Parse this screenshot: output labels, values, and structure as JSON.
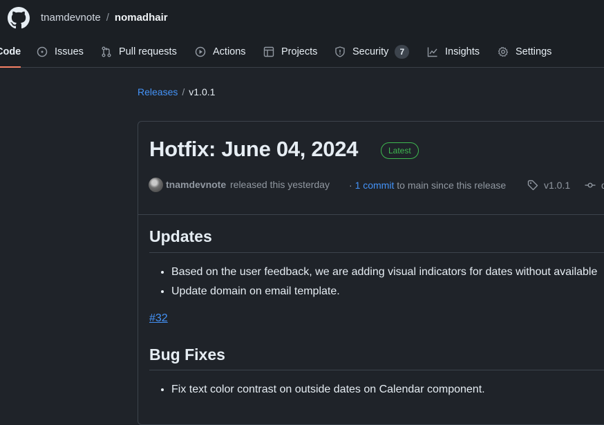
{
  "repo": {
    "owner": "tnamdevnote",
    "separator": "/",
    "name": "nomadhair"
  },
  "tabs": [
    {
      "label": "Code",
      "icon": "code-icon",
      "active": true
    },
    {
      "label": "Issues",
      "icon": "issue-opened-icon"
    },
    {
      "label": "Pull requests",
      "icon": "git-pull-request-icon"
    },
    {
      "label": "Actions",
      "icon": "play-icon"
    },
    {
      "label": "Projects",
      "icon": "table-icon"
    },
    {
      "label": "Security",
      "icon": "shield-icon",
      "count": "7"
    },
    {
      "label": "Insights",
      "icon": "graph-icon"
    },
    {
      "label": "Settings",
      "icon": "gear-icon"
    }
  ],
  "breadcrumb": {
    "releases": "Releases",
    "separator": "/",
    "current": "v1.0.1"
  },
  "release": {
    "title": "Hotfix: June 04, 2024",
    "badge": "Latest",
    "author": "tnamdevnote",
    "released_text": "released this yesterday",
    "commits_prefix": "·",
    "commits_link": "1 commit",
    "commits_suffix": "to main since this release",
    "tag": "v1.0.1",
    "commit_hash": "d"
  },
  "body": {
    "updates_heading": "Updates",
    "updates": [
      "Based on the user feedback, we are adding visual indicators for dates without available",
      "Update domain on email template."
    ],
    "issue_link": "#32",
    "bugfix_heading": "Bug Fixes",
    "bugfixes": [
      "Fix text color contrast on outside dates on Calendar component."
    ]
  },
  "colors": {
    "background": "#1f2329",
    "header_bg": "#1b1f24",
    "link": "#4493f8",
    "active_underline": "#f78166",
    "latest_badge": "#3fb950"
  }
}
